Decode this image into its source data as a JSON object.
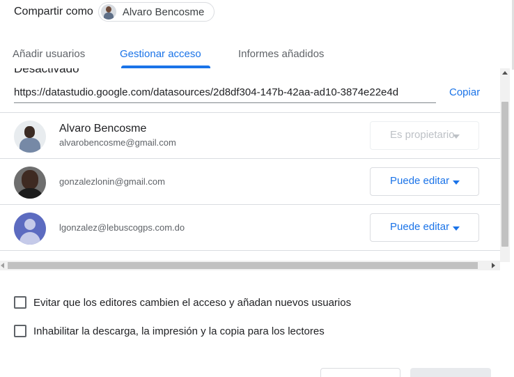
{
  "share_as": {
    "label": "Compartir como",
    "owner_name": "Alvaro Bencosme"
  },
  "tabs": [
    {
      "label": "Añadir usuarios",
      "active": false
    },
    {
      "label": "Gestionar acceso",
      "active": true
    },
    {
      "label": "Informes añadidos",
      "active": false
    }
  ],
  "link_section": {
    "status_text": "Desactivado",
    "url": "https://datastudio.google.com/datasources/2d8df304-147b-42aa-ad10-3874e22e4d",
    "copy_label": "Copiar"
  },
  "users": [
    {
      "name": "Alvaro Bencosme",
      "email": "alvarobencosme@gmail.com",
      "role": "Es propietario",
      "role_enabled": false,
      "avatar": "photo"
    },
    {
      "name": "",
      "email": "gonzalezlonin@gmail.com",
      "role": "Puede editar",
      "role_enabled": true,
      "avatar": "photo"
    },
    {
      "name": "",
      "email": "lgonzalez@lebuscogps.com.do",
      "role": "Puede editar",
      "role_enabled": true,
      "avatar": "generic-person-icon"
    }
  ],
  "options": [
    {
      "label": "Evitar que los editores cambien el acceso y añadan nuevos usuarios",
      "checked": false
    },
    {
      "label": "Inhabilitar la descarga, la impresión y la copia para los lectores",
      "checked": false
    }
  ],
  "colors": {
    "accent": "#1a73e8",
    "text": "#202124",
    "secondary_text": "#5f6368",
    "divider": "#dadce0",
    "disabled_text": "#bdc1c6"
  }
}
